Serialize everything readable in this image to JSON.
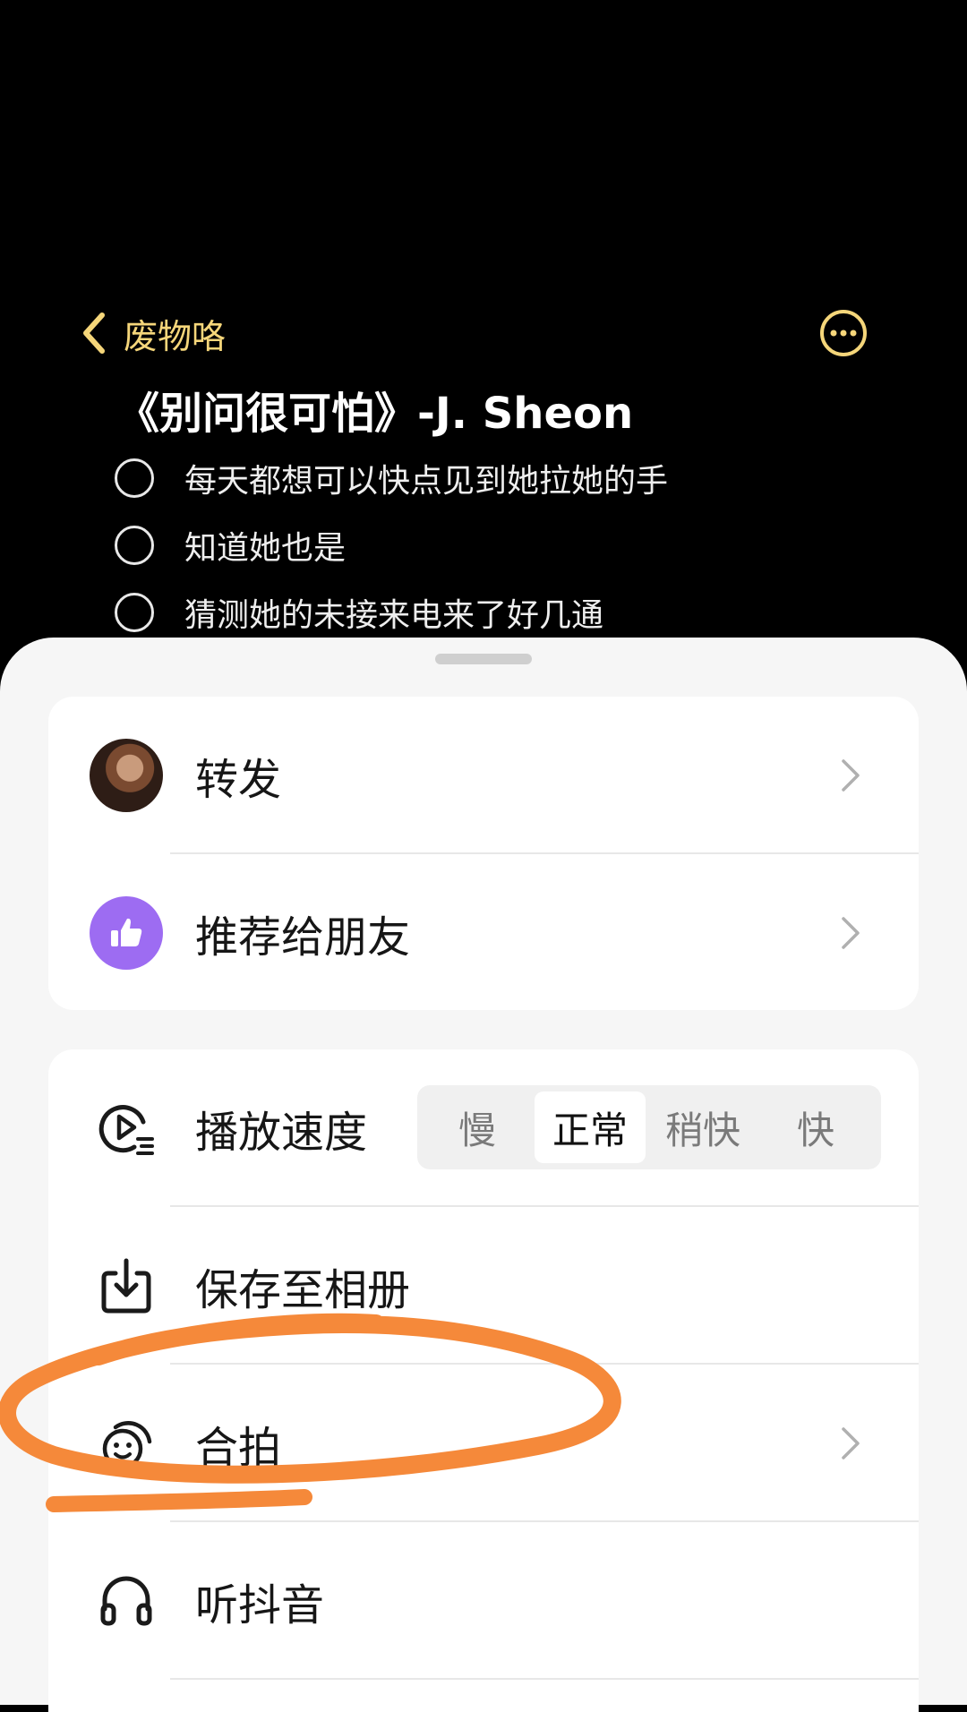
{
  "header": {
    "back_label": "废物咯"
  },
  "note": {
    "title": "《别问很可怕》-J. Sheon",
    "todos": [
      "每天都想可以快点见到她拉她的手",
      "知道她也是",
      "猜测她的未接来电来了好几通"
    ]
  },
  "share_card": {
    "items": [
      {
        "label": "转发",
        "icon": "avatar"
      },
      {
        "label": "推荐给朋友",
        "icon": "thumbs-up-icon"
      }
    ]
  },
  "actions_card": {
    "speed": {
      "label": "播放速度",
      "icon": "playback-speed-icon",
      "options": [
        "慢",
        "正常",
        "稍快",
        "快"
      ],
      "selected": "正常"
    },
    "items": [
      {
        "label": "保存至相册",
        "icon": "download-icon"
      },
      {
        "label": "合拍",
        "icon": "duet-icon"
      },
      {
        "label": "听抖音",
        "icon": "headphones-icon"
      }
    ]
  },
  "colors": {
    "accent_yellow": "#F5D67A",
    "thumb_purple": "#9D6CF2",
    "annotation_orange": "#F5893A"
  }
}
